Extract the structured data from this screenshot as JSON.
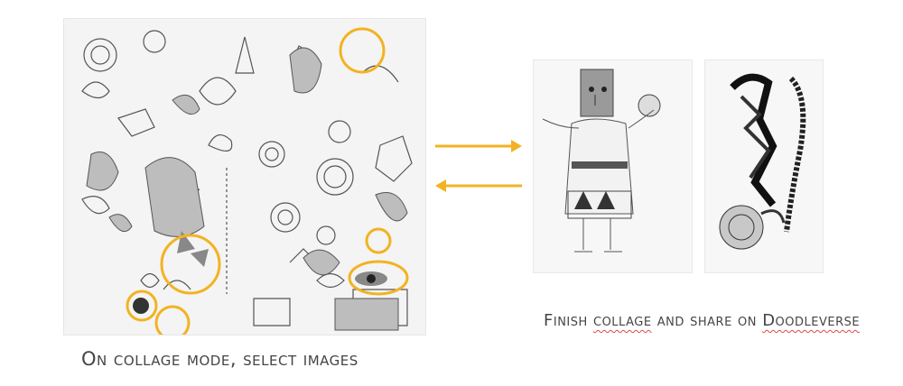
{
  "colors": {
    "highlight": "#f2b321",
    "ink": "#3a3a3a",
    "caption": "#454545",
    "spellcheck": "#d84a4a"
  },
  "left_caption": "On collage mode, select images",
  "right_caption": {
    "part1": "Finish ",
    "collage_word": "collage",
    "part2": " and share on ",
    "doodleverse_word": "Doodleverse"
  },
  "icons": {
    "arrow_right": "arrow-right-icon",
    "arrow_left": "arrow-left-icon"
  }
}
